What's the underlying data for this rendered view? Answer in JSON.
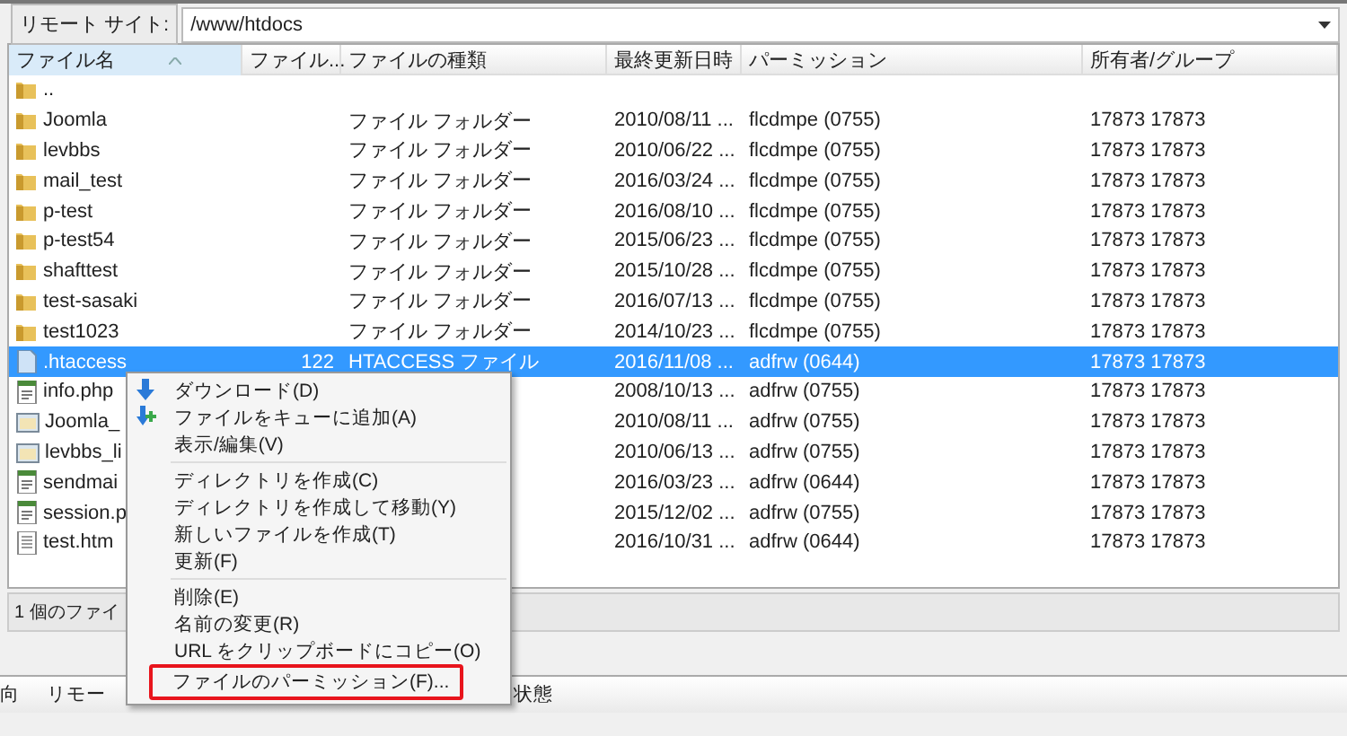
{
  "remote_site": {
    "label": "リモート サイト:",
    "path": "/www/htdocs"
  },
  "table": {
    "columns": [
      {
        "label": "ファイル名",
        "sorted": true
      },
      {
        "label": "ファイル...",
        "sorted": false
      },
      {
        "label": "ファイルの種類",
        "sorted": false
      },
      {
        "label": "最終更新日時",
        "sorted": false
      },
      {
        "label": "パーミッション",
        "sorted": false
      },
      {
        "label": "所有者/グループ",
        "sorted": false
      }
    ],
    "rows": [
      {
        "kind": "folder",
        "name": "..",
        "selected": false
      },
      {
        "kind": "folder",
        "name": "Joomla",
        "type": "ファイル フォルダー",
        "modified": "2010/08/11 ...",
        "permission": "flcdmpe (0755)",
        "owner": "17873 17873",
        "selected": false
      },
      {
        "kind": "folder",
        "name": "levbbs",
        "type": "ファイル フォルダー",
        "modified": "2010/06/22 ...",
        "permission": "flcdmpe (0755)",
        "owner": "17873 17873",
        "selected": false
      },
      {
        "kind": "folder",
        "name": "mail_test",
        "type": "ファイル フォルダー",
        "modified": "2016/03/24 ...",
        "permission": "flcdmpe (0755)",
        "owner": "17873 17873",
        "selected": false
      },
      {
        "kind": "folder",
        "name": "p-test",
        "type": "ファイル フォルダー",
        "modified": "2016/08/10 ...",
        "permission": "flcdmpe (0755)",
        "owner": "17873 17873",
        "selected": false
      },
      {
        "kind": "folder",
        "name": "p-test54",
        "type": "ファイル フォルダー",
        "modified": "2015/06/23 ...",
        "permission": "flcdmpe (0755)",
        "owner": "17873 17873",
        "selected": false
      },
      {
        "kind": "folder",
        "name": "shafttest",
        "type": "ファイル フォルダー",
        "modified": "2015/10/28 ...",
        "permission": "flcdmpe (0755)",
        "owner": "17873 17873",
        "selected": false
      },
      {
        "kind": "folder",
        "name": "test-sasaki",
        "type": "ファイル フォルダー",
        "modified": "2016/07/13 ...",
        "permission": "flcdmpe (0755)",
        "owner": "17873 17873",
        "selected": false
      },
      {
        "kind": "folder",
        "name": "test1023",
        "type": "ファイル フォルダー",
        "modified": "2014/10/23 ...",
        "permission": "flcdmpe (0755)",
        "owner": "17873 17873",
        "selected": false
      },
      {
        "kind": "file",
        "name": ".htaccess",
        "size": "122",
        "type": "HTACCESS ファイル",
        "modified": "2016/11/08 ...",
        "permission": "adfrw (0644)",
        "owner": "17873 17873",
        "selected": true
      },
      {
        "kind": "script",
        "name": "info.php",
        "modified": "2008/10/13 ...",
        "permission": "adfrw (0755)",
        "owner": "17873 17873",
        "selected": false
      },
      {
        "kind": "archive",
        "name": "Joomla_",
        "modified": "2010/08/11 ...",
        "permission": "adfrw (0755)",
        "owner": "17873 17873",
        "selected": false
      },
      {
        "kind": "archive",
        "name": "levbbs_li",
        "modified": "2010/06/13 ...",
        "permission": "adfrw (0755)",
        "owner": "17873 17873",
        "selected": false
      },
      {
        "kind": "script",
        "name": "sendmai",
        "modified": "2016/03/23 ...",
        "permission": "adfrw (0644)",
        "owner": "17873 17873",
        "selected": false
      },
      {
        "kind": "script",
        "name": "session.p",
        "modified": "2015/12/02 ...",
        "permission": "adfrw (0755)",
        "owner": "17873 17873",
        "selected": false
      },
      {
        "kind": "document",
        "name": "test.htm",
        "modified": "2016/10/31 ...",
        "permission": "adfrw (0644)",
        "owner": "17873 17873",
        "selected": false
      }
    ]
  },
  "status_bar": "1 個のファイ",
  "queue_columns": [
    "向",
    "リモー",
    "状態"
  ],
  "context_menu": [
    {
      "kind": "download",
      "label": "ダウンロード(D)",
      "highlighted": false
    },
    {
      "kind": "queue",
      "label": "ファイルをキューに追加(A)",
      "highlighted": false
    },
    {
      "kind": "item",
      "label": "表示/編集(V)",
      "highlighted": false
    },
    {
      "kind": "separator"
    },
    {
      "kind": "item",
      "label": "ディレクトリを作成(C)",
      "highlighted": false
    },
    {
      "kind": "item",
      "label": "ディレクトリを作成して移動(Y)",
      "highlighted": false
    },
    {
      "kind": "item",
      "label": "新しいファイルを作成(T)",
      "highlighted": false
    },
    {
      "kind": "item",
      "label": "更新(F)",
      "highlighted": false
    },
    {
      "kind": "separator"
    },
    {
      "kind": "item",
      "label": "削除(E)",
      "highlighted": false
    },
    {
      "kind": "item",
      "label": "名前の変更(R)",
      "highlighted": false
    },
    {
      "kind": "item",
      "label": "URL をクリップボードにコピー(O)",
      "highlighted": false
    },
    {
      "kind": "item",
      "label": "ファイルのパーミッション(F)...",
      "highlighted": true
    }
  ]
}
